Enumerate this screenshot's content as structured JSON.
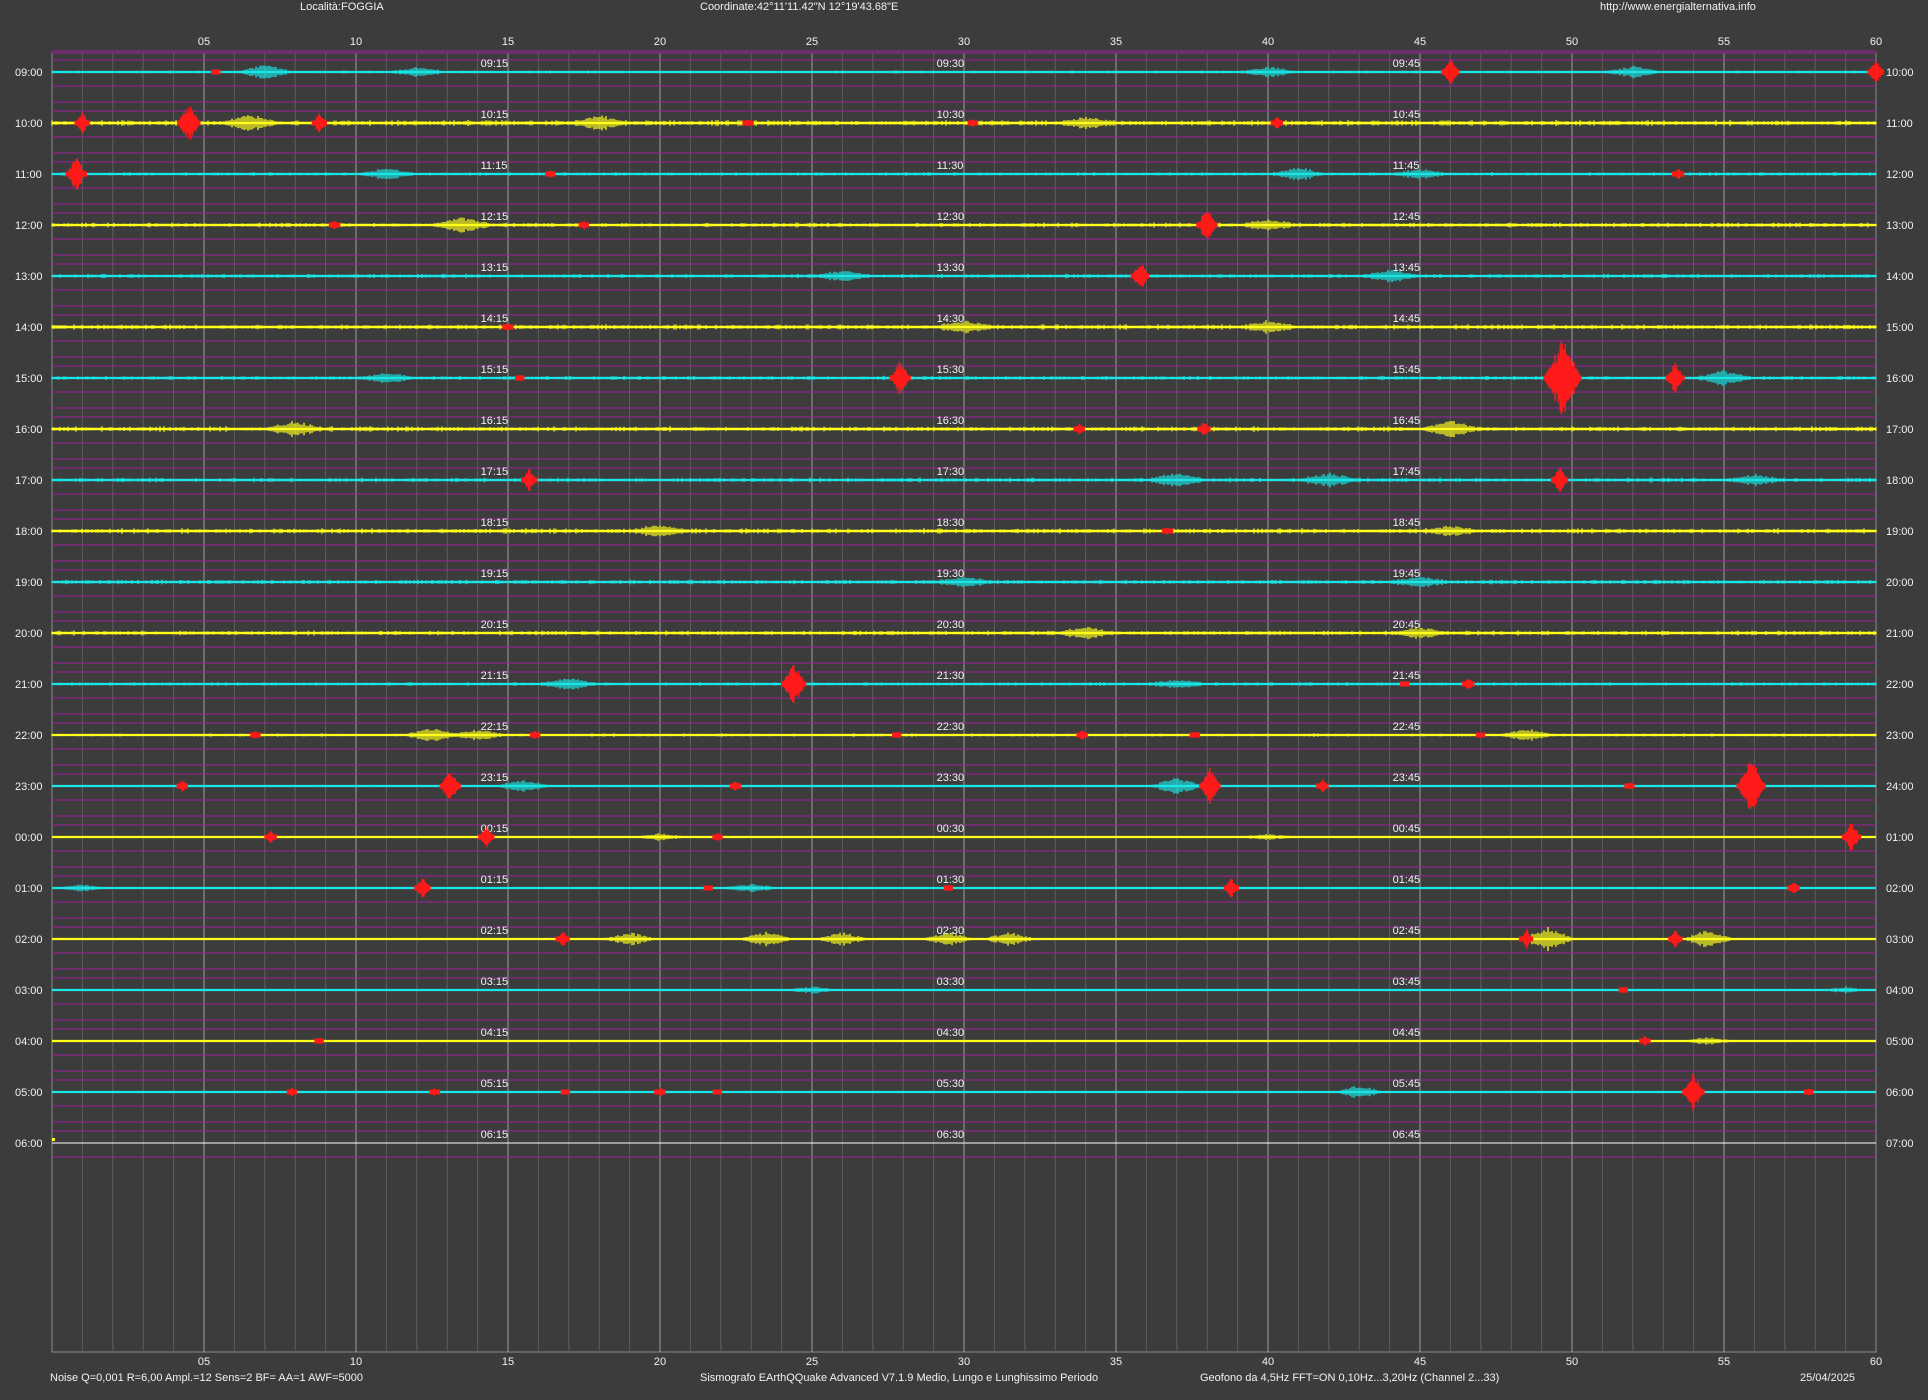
{
  "header": {
    "location": "Località:FOGGIA",
    "coordinates": "Coordinate:42°11'11.42\"N  12°19'43.68\"E",
    "website": "http://www.energialternativa.info"
  },
  "footer": {
    "settings": "Noise Q=0,001 R=6,00 Ampl.=12 Sens=2 BF= AA=1 AWF=5000",
    "software": "Sismografo  EArthQQuake Advanced V7.1.9  Medio, Lungo e Lunghissimo Periodo",
    "sensor": "Geofono da 4,5Hz FFT=ON 0,10Hz...3,20Hz      (Channel 2...33)",
    "date": "25/04/2025"
  },
  "minute_ticks": [
    "05",
    "10",
    "15",
    "20",
    "25",
    "30",
    "35",
    "40",
    "45",
    "50",
    "55",
    "60"
  ],
  "colors": {
    "background": "#3c3c3c",
    "trace_odd": "#19e6e6",
    "trace_even": "#ffff1a",
    "event": "#ff1a1a",
    "hour_guide": "#a020a0",
    "grid_major": "#bfbfbf",
    "grid_minor": "#5e5e5e"
  },
  "rows": [
    {
      "left": "09:00",
      "right": "10:00",
      "q1": "09:15",
      "q2": "09:30",
      "q3": "09:45",
      "amp": 0.3,
      "events": [
        [
          5.4,
          0.4
        ],
        [
          46.0,
          1.6
        ],
        [
          60,
          1.4
        ]
      ],
      "bursts": [
        [
          7,
          1.0
        ],
        [
          12,
          0.6
        ],
        [
          40,
          0.7
        ],
        [
          52,
          0.8
        ]
      ]
    },
    {
      "left": "10:00",
      "right": "11:00",
      "q1": "10:15",
      "q2": "10:30",
      "q3": "10:45",
      "amp": 0.55,
      "events": [
        [
          1.0,
          1.2
        ],
        [
          4.5,
          2.3
        ],
        [
          8.8,
          1.2
        ],
        [
          22.9,
          0.6
        ],
        [
          30.3,
          0.5
        ],
        [
          40.3,
          0.8
        ]
      ],
      "bursts": [
        [
          6.5,
          1.0
        ],
        [
          18,
          0.8
        ],
        [
          34,
          0.7
        ]
      ]
    },
    {
      "left": "11:00",
      "right": "12:00",
      "q1": "11:15",
      "q2": "11:30",
      "q3": "11:45",
      "amp": 0.35,
      "events": [
        [
          0.8,
          2.0
        ],
        [
          16.4,
          0.5
        ],
        [
          53.5,
          0.8
        ]
      ],
      "bursts": [
        [
          11,
          0.8
        ],
        [
          41,
          0.8
        ],
        [
          45,
          0.6
        ]
      ]
    },
    {
      "left": "12:00",
      "right": "13:00",
      "q1": "12:15",
      "q2": "12:30",
      "q3": "12:45",
      "amp": 0.45,
      "events": [
        [
          9.3,
          0.6
        ],
        [
          17.5,
          0.5
        ],
        [
          38.0,
          2.1
        ]
      ],
      "bursts": [
        [
          13.5,
          1.0
        ],
        [
          40,
          0.7
        ]
      ]
    },
    {
      "left": "13:00",
      "right": "14:00",
      "q1": "13:15",
      "q2": "13:30",
      "q3": "13:45",
      "amp": 0.4,
      "events": [
        [
          35.8,
          1.7
        ]
      ],
      "bursts": [
        [
          26,
          0.7
        ],
        [
          44,
          0.8
        ]
      ]
    },
    {
      "left": "14:00",
      "right": "15:00",
      "q1": "14:15",
      "q2": "14:30",
      "q3": "14:45",
      "amp": 0.5,
      "events": [
        [
          15.0,
          0.6
        ]
      ],
      "bursts": [
        [
          30,
          0.8
        ],
        [
          40,
          0.7
        ]
      ]
    },
    {
      "left": "15:00",
      "right": "16:00",
      "q1": "15:15",
      "q2": "15:30",
      "q3": "15:45",
      "amp": 0.4,
      "events": [
        [
          15.4,
          0.4
        ],
        [
          27.9,
          2.0
        ],
        [
          49.7,
          4.5
        ],
        [
          53.4,
          1.8
        ]
      ],
      "bursts": [
        [
          11,
          0.6
        ],
        [
          55,
          1.0
        ]
      ]
    },
    {
      "left": "16:00",
      "right": "17:00",
      "q1": "16:15",
      "q2": "16:30",
      "q3": "16:45",
      "amp": 0.5,
      "events": [
        [
          33.8,
          0.7
        ],
        [
          37.9,
          0.9
        ]
      ],
      "bursts": [
        [
          8,
          0.9
        ],
        [
          46,
          1.1
        ]
      ]
    },
    {
      "left": "17:00",
      "right": "18:00",
      "q1": "17:15",
      "q2": "17:30",
      "q3": "17:45",
      "amp": 0.45,
      "events": [
        [
          15.7,
          1.3
        ],
        [
          49.6,
          1.5
        ]
      ],
      "bursts": [
        [
          37,
          0.9
        ],
        [
          42,
          0.9
        ],
        [
          56,
          0.7
        ]
      ]
    },
    {
      "left": "18:00",
      "right": "19:00",
      "q1": "18:15",
      "q2": "18:30",
      "q3": "18:45",
      "amp": 0.5,
      "events": [
        [
          36.7,
          0.6
        ]
      ],
      "bursts": [
        [
          20,
          0.7
        ],
        [
          46,
          0.6
        ]
      ]
    },
    {
      "left": "19:00",
      "right": "20:00",
      "q1": "19:15",
      "q2": "19:30",
      "q3": "19:45",
      "amp": 0.45,
      "events": [],
      "bursts": [
        [
          30,
          0.6
        ],
        [
          45,
          0.6
        ]
      ]
    },
    {
      "left": "20:00",
      "right": "21:00",
      "q1": "20:15",
      "q2": "20:30",
      "q3": "20:45",
      "amp": 0.45,
      "events": [],
      "bursts": [
        [
          34,
          0.7
        ],
        [
          45,
          0.7
        ]
      ]
    },
    {
      "left": "21:00",
      "right": "22:00",
      "q1": "21:15",
      "q2": "21:30",
      "q3": "21:45",
      "amp": 0.35,
      "events": [
        [
          24.4,
          2.6
        ],
        [
          44.5,
          0.3
        ],
        [
          46.6,
          0.8
        ]
      ],
      "bursts": [
        [
          17,
          0.8
        ],
        [
          37,
          0.6
        ]
      ]
    },
    {
      "left": "22:00",
      "right": "23:00",
      "q1": "22:15",
      "q2": "22:30",
      "q3": "22:45",
      "amp": 0.3,
      "events": [
        [
          6.7,
          0.5
        ],
        [
          15.9,
          0.5
        ],
        [
          27.8,
          0.4
        ],
        [
          33.9,
          0.7
        ],
        [
          37.6,
          0.5
        ],
        [
          47.0,
          0.4
        ]
      ],
      "bursts": [
        [
          12.5,
          0.9
        ],
        [
          14,
          0.7
        ],
        [
          48.5,
          0.9
        ]
      ]
    },
    {
      "left": "23:00",
      "right": "24:00",
      "q1": "23:15",
      "q2": "23:30",
      "q3": "23:45",
      "amp": 0.2,
      "events": [
        [
          4.3,
          0.7
        ],
        [
          13.1,
          2.0
        ],
        [
          22.5,
          0.7
        ],
        [
          38.1,
          2.1
        ],
        [
          41.8,
          0.8
        ],
        [
          51.9,
          0.5
        ],
        [
          55.9,
          3.2
        ]
      ],
      "bursts": [
        [
          15.5,
          1.0
        ],
        [
          37,
          1.2
        ]
      ]
    },
    {
      "left": "00:00",
      "right": "01:00",
      "q1": "00:15",
      "q2": "00:30",
      "q3": "00:45",
      "amp": 0.15,
      "events": [
        [
          7.2,
          0.8
        ],
        [
          14.3,
          1.4
        ],
        [
          21.9,
          0.5
        ],
        [
          59.2,
          1.8
        ]
      ],
      "bursts": [
        [
          20,
          0.5
        ],
        [
          40,
          0.4
        ]
      ]
    },
    {
      "left": "01:00",
      "right": "02:00",
      "q1": "01:15",
      "q2": "01:30",
      "q3": "01:45",
      "amp": 0.15,
      "events": [
        [
          12.2,
          1.4
        ],
        [
          21.6,
          0.4
        ],
        [
          29.5,
          0.4
        ],
        [
          38.8,
          1.2
        ],
        [
          57.3,
          0.8
        ]
      ],
      "bursts": [
        [
          23,
          0.6
        ],
        [
          1,
          0.5
        ]
      ]
    },
    {
      "left": "02:00",
      "right": "03:00",
      "q1": "02:15",
      "q2": "02:30",
      "q3": "02:45",
      "amp": 0.08,
      "events": [
        [
          16.8,
          1.0
        ],
        [
          48.5,
          1.1
        ],
        [
          53.4,
          1.0
        ]
      ],
      "bursts": [
        [
          19,
          1.0
        ],
        [
          23.5,
          1.2
        ],
        [
          26,
          1.0
        ],
        [
          29.5,
          1.0
        ],
        [
          31.5,
          1.0
        ],
        [
          49.2,
          1.8
        ],
        [
          54.5,
          1.4
        ]
      ]
    },
    {
      "left": "03:00",
      "right": "04:00",
      "q1": "03:15",
      "q2": "03:30",
      "q3": "03:45",
      "amp": 0.05,
      "events": [
        [
          51.7,
          0.4
        ]
      ],
      "bursts": [
        [
          25,
          0.6
        ],
        [
          59,
          0.5
        ]
      ]
    },
    {
      "left": "04:00",
      "right": "05:00",
      "q1": "04:15",
      "q2": "04:30",
      "q3": "04:45",
      "amp": 0.05,
      "events": [
        [
          8.8,
          0.4
        ],
        [
          52.4,
          0.6
        ]
      ],
      "bursts": [
        [
          54.5,
          0.6
        ]
      ]
    },
    {
      "left": "05:00",
      "right": "06:00",
      "q1": "05:15",
      "q2": "05:30",
      "q3": "05:45",
      "amp": 0.05,
      "events": [
        [
          7.9,
          0.5
        ],
        [
          12.6,
          0.5
        ],
        [
          16.9,
          0.4
        ],
        [
          20.0,
          0.6
        ],
        [
          21.9,
          0.4
        ],
        [
          54.0,
          2.2
        ],
        [
          57.8,
          0.4
        ]
      ],
      "bursts": [
        [
          43,
          1.0
        ]
      ]
    },
    {
      "left": "06:00",
      "right": "07:00",
      "q1": "06:15",
      "q2": "06:30",
      "q3": "06:45",
      "amp": 0.0,
      "events": [],
      "bursts": []
    }
  ]
}
